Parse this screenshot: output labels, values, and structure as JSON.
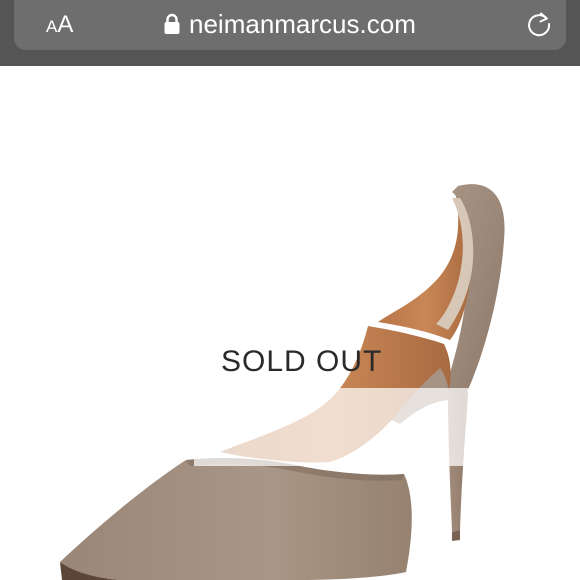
{
  "browser": {
    "text_size_small": "A",
    "text_size_large": "A",
    "url": "neimanmarcus.com",
    "icons": {
      "lock": "lock-icon",
      "reload": "reload-icon"
    },
    "bar_color": "#555555",
    "pill_color": "#6e6e6e"
  },
  "product": {
    "status": "SOLD OUT",
    "image_description_icon": "shoe-image"
  }
}
